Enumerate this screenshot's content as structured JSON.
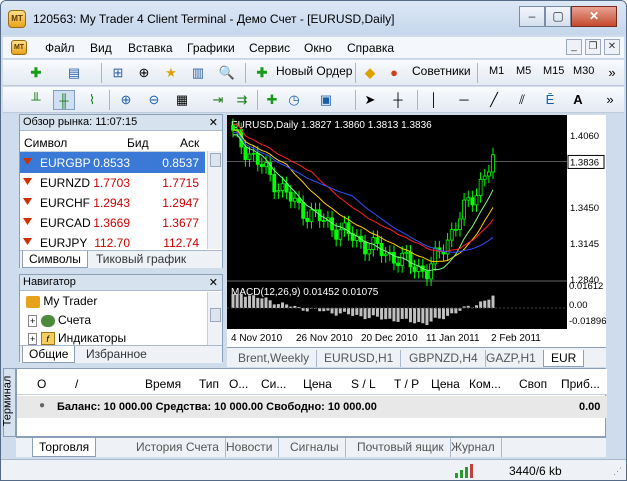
{
  "window": {
    "title": "120563: My Trader 4 Client Terminal - Демо Счет - [EURUSD,Daily]",
    "logo": "MT"
  },
  "menu": {
    "items": [
      "Файл",
      "Вид",
      "Вставка",
      "Графики",
      "Сервис",
      "Окно",
      "Справка"
    ]
  },
  "toolbar1": {
    "new_order": "Новый Ордер",
    "experts": "Советники",
    "timeframes": [
      "M1",
      "M5",
      "M15",
      "M30"
    ]
  },
  "toolbar2": {
    "text_tool": "A"
  },
  "market_watch": {
    "title": "Обзор рынка: 11:07:15",
    "columns": {
      "symbol": "Символ",
      "bid": "Бид",
      "ask": "Аск"
    },
    "rows": [
      {
        "symbol": "EURGBP",
        "bid": "0.8533",
        "ask": "0.8537",
        "selected": true
      },
      {
        "symbol": "EURNZD",
        "bid": "1.7703",
        "ask": "1.7715"
      },
      {
        "symbol": "EURCHF",
        "bid": "1.2943",
        "ask": "1.2947"
      },
      {
        "symbol": "EURCAD",
        "bid": "1.3669",
        "ask": "1.3677"
      },
      {
        "symbol": "EURJPY",
        "bid": "112.70",
        "ask": "112.74"
      }
    ],
    "tabs": [
      "Символы",
      "Тиковый график"
    ]
  },
  "navigator": {
    "title": "Навигатор",
    "items": [
      "My Trader",
      "Счета",
      "Индикаторы"
    ],
    "tabs": [
      "Общие",
      "Избранное"
    ]
  },
  "chart": {
    "header": "EURUSD,Daily  1.3827 1.3860 1.3813 1.3836",
    "price_labels": [
      "1.4060",
      "1.3836",
      "1.3450",
      "1.3145",
      "1.2840"
    ],
    "macd_label": "MACD(12,26,9) 0.01452 0.01075",
    "macd_scale": [
      "0.01612",
      "0.00",
      "-0.01896"
    ],
    "dates": [
      "4 Nov 2010",
      "26 Nov 2010",
      "20 Dec 2010",
      "11 Jan 2011",
      "2 Feb 2011"
    ],
    "tabs": [
      "Brent,Weekly",
      "EURUSD,H1",
      "GBPNZD,H4",
      "GAZP,H1",
      "EUR"
    ]
  },
  "chart_data": {
    "type": "line",
    "title": "EURUSD,Daily",
    "xlabel": "",
    "ylabel": "",
    "x": [
      "4 Nov 2010",
      "26 Nov 2010",
      "20 Dec 2010",
      "11 Jan 2011",
      "2 Feb 2011"
    ],
    "ylim": [
      1.284,
      1.406
    ],
    "series": [
      {
        "name": "EURUSD",
        "values": [
          1.406,
          1.345,
          1.3145,
          1.29,
          1.3836
        ]
      }
    ],
    "colors": {
      "candles": "#00ff00",
      "ma_red": "#ff2020",
      "ma_blue": "#3050ff",
      "ma_yellow": "#ffd000",
      "ma_green": "#80ff80"
    }
  },
  "terminal": {
    "side_label": "Терминал",
    "columns": [
      "Ордер",
      "/",
      "Время",
      "Тип",
      "Объем",
      "Символ",
      "Цена",
      "S / L",
      "T / P",
      "Цена",
      "Комиссия",
      "Своп",
      "Прибыль"
    ],
    "columns_visible": [
      "О",
      "/",
      "Время",
      "Тип",
      "О...",
      "Си...",
      "Цена",
      "S / L",
      "T / P",
      "Цена",
      "Ком...",
      "Своп",
      "Приб..."
    ],
    "balance_line": "Баланс: 10 000.00  Средства: 10 000.00  Свободно: 10 000.00",
    "profit": "0.00",
    "tabs": [
      "Торговля",
      "История Счета",
      "Новости",
      "Сигналы",
      "Почтовый ящик",
      "Журнал"
    ]
  },
  "status": {
    "traffic": "3440/6 kb"
  }
}
